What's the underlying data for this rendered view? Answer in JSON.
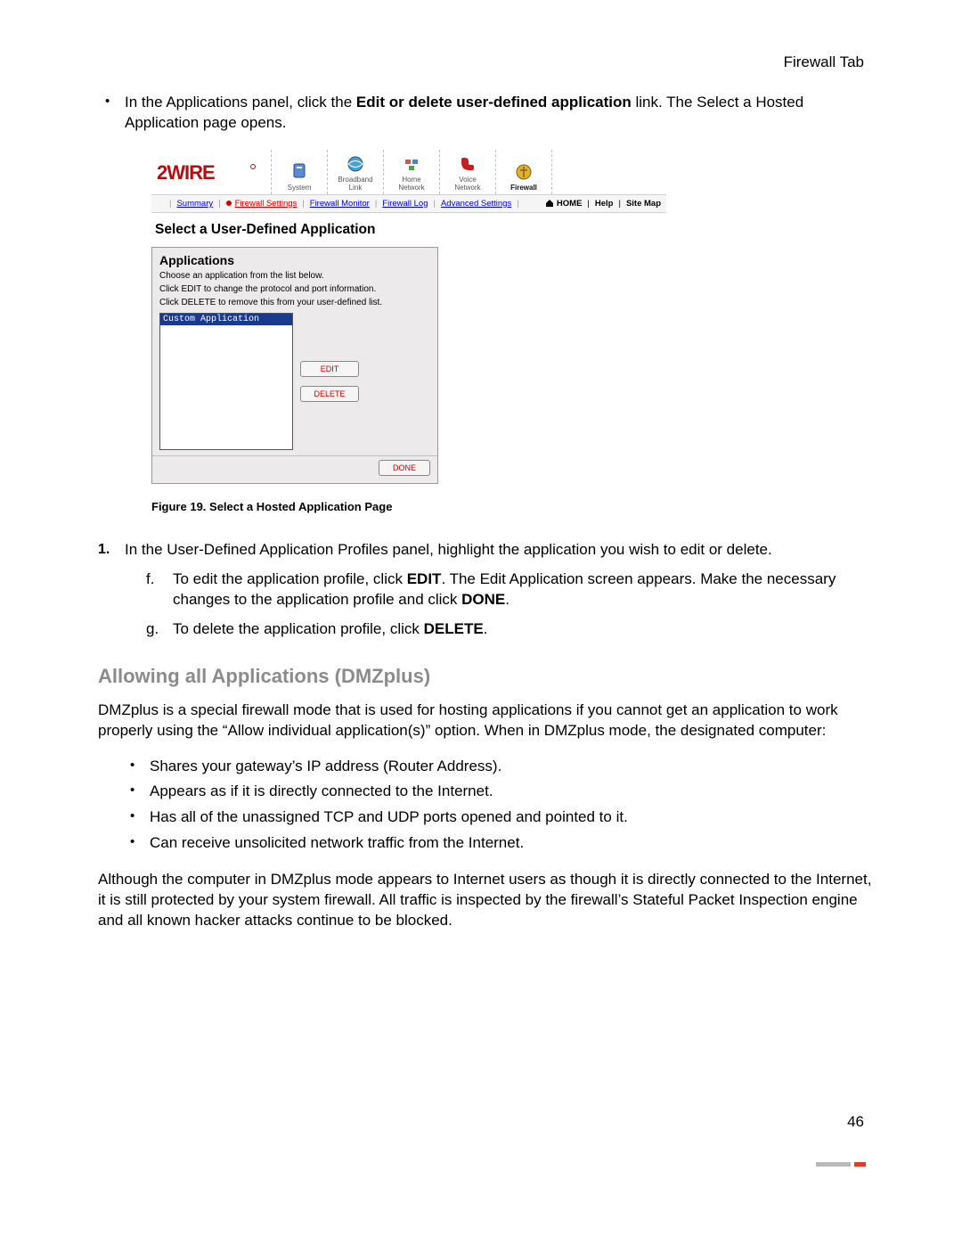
{
  "header": {
    "section": "Firewall Tab"
  },
  "intro": {
    "prefix": "In the Applications panel, click the ",
    "link_bold": "Edit or delete user-defined application",
    "suffix": " link. The Select a Hosted Application page opens."
  },
  "figure": {
    "logo_text": "2WIRE",
    "nav": [
      {
        "label": "System",
        "icon": "system-icon"
      },
      {
        "label": "Broadband\nLink",
        "icon": "broadband-icon"
      },
      {
        "label": "Home\nNetwork",
        "icon": "home-network-icon"
      },
      {
        "label": "Voice\nNetwork",
        "icon": "voice-icon"
      },
      {
        "label": "Firewall",
        "icon": "firewall-icon",
        "active": true
      }
    ],
    "subnav": {
      "summary": "Summary",
      "firewall_settings": "Firewall Settings",
      "firewall_monitor": "Firewall Monitor",
      "firewall_log": "Firewall Log",
      "advanced_settings": "Advanced Settings",
      "home": "HOME",
      "help": "Help",
      "site_map": "Site Map"
    },
    "page_title": "Select a User-Defined Application",
    "panel": {
      "title": "Applications",
      "line1": "Choose an application from the list below.",
      "line2": "Click EDIT to change the protocol and port information.",
      "line3": "Click DELETE to remove this from your user-defined list.",
      "selected_item": "Custom Application",
      "edit_btn": "EDIT",
      "delete_btn": "DELETE",
      "done_btn": "DONE"
    },
    "caption": "Figure 19. Select a Hosted Application Page"
  },
  "steps": {
    "step1": {
      "marker": "1.",
      "text": "In the User-Defined Application Profiles panel, highlight the application you wish to edit or delete."
    },
    "sub_f": {
      "marker": "f.",
      "p1": "To edit the application profile, click ",
      "b1": "EDIT",
      "p2": ". The Edit Application screen appears. Make the necessary changes to the application profile and click ",
      "b2": "DONE",
      "p3": "."
    },
    "sub_g": {
      "marker": "g.",
      "p1": "To delete the application profile, click ",
      "b1": "DELETE",
      "p2": "."
    }
  },
  "section": {
    "heading": "Allowing all Applications (DMZplus)",
    "para1": "DMZplus is a special firewall mode that is used for hosting applications if you cannot get an application to work properly using the “Allow individual application(s)” option. When in DMZplus mode, the designated computer:",
    "bullets": [
      "Shares your gateway’s IP address (Router Address).",
      "Appears as if it is directly connected to the Internet.",
      "Has all of the unassigned TCP and UDP ports opened and pointed to it.",
      "Can receive unsolicited network traffic from the Internet."
    ],
    "para2": "Although the computer in DMZplus mode appears to Internet users as though it is directly connected to the Internet, it is still protected by your system firewall. All traffic is inspected by the firewall’s Stateful Packet Inspection engine and all known hacker attacks continue to be blocked."
  },
  "page_number": "46"
}
